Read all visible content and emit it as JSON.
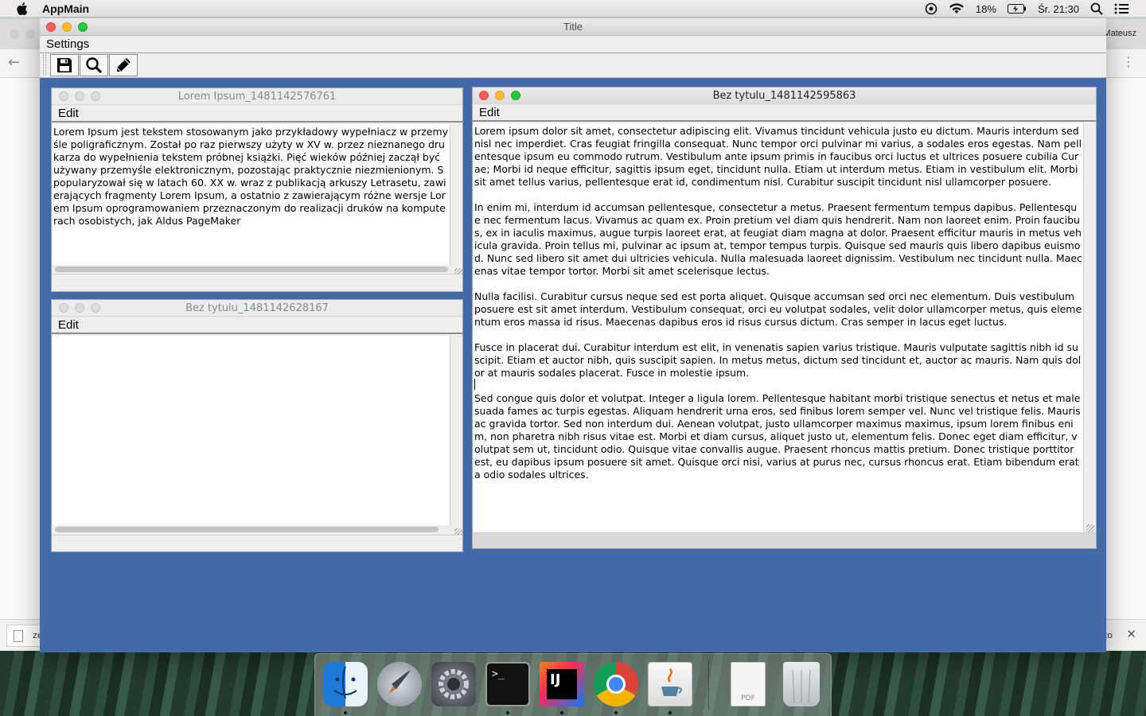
{
  "menubar": {
    "app_name": "AppMain",
    "battery": "18%",
    "clock": "Śr. 21:30"
  },
  "background_browser": {
    "user": "Mateusz",
    "download_file": "ze",
    "download_right": "ko"
  },
  "main_window": {
    "title": "Title",
    "menu_settings": "Settings",
    "toolbar": [
      "save-icon",
      "search-icon",
      "pencil-icon"
    ]
  },
  "frames": {
    "lorem": {
      "title": "Lorem Ipsum_1481142576761",
      "menu_edit": "Edit",
      "text": "Lorem Ipsum jest tekstem stosowanym jako przykładowy wypełniacz w przemyśle poligraficznym. Został po raz pierwszy użyty w XV w. przez nieznanego drukarza do wypełnienia tekstem próbnej książki. Pięć wieków później zaczął być używany przemyśle elektronicznym, pozostając praktycznie niezmienionym. Spopularyzował się w latach 60. XX w. wraz z publikacją arkuszy Letrasetu, zawierających fragmenty Lorem Ipsum, a ostatnio z zawierającym różne wersje Lorem Ipsum oprogramowaniem przeznaczonym do realizacji druków na komputerach osobistych, jak Aldus PageMaker"
    },
    "empty": {
      "title": "Bez tytulu_1481142628167",
      "menu_edit": "Edit",
      "text": ""
    },
    "big": {
      "title": "Bez tytulu_1481142595863",
      "menu_edit": "Edit",
      "text": "Lorem ipsum dolor sit amet, consectetur adipiscing elit. Vivamus tincidunt vehicula justo eu dictum. Mauris interdum sed nisl nec imperdiet. Cras feugiat fringilla consequat. Nunc tempor orci pulvinar mi varius, a sodales eros egestas. Nam pellentesque ipsum eu commodo rutrum. Vestibulum ante ipsum primis in faucibus orci luctus et ultrices posuere cubilia Curae; Morbi id neque efficitur, sagittis ipsum eget, tincidunt nulla. Etiam ut interdum metus. Etiam in vestibulum elit. Morbi sit amet tellus varius, pellentesque erat id, condimentum nisl. Curabitur suscipit tincidunt nisl ullamcorper posuere.\n\nIn enim mi, interdum id accumsan pellentesque, consectetur a metus. Praesent fermentum tempus dapibus. Pellentesque nec fermentum lacus. Vivamus ac quam ex. Proin pretium vel diam quis hendrerit. Nam non laoreet enim. Proin faucibus, ex in iaculis maximus, augue turpis laoreet erat, at feugiat diam magna at dolor. Praesent efficitur mauris in metus vehicula gravida. Proin tellus mi, pulvinar ac ipsum at, tempor tempus turpis. Quisque sed mauris quis libero dapibus euismod. Nunc sed libero sit amet dui ultricies vehicula. Nulla malesuada laoreet dignissim. Vestibulum nec tincidunt nulla. Maecenas vitae tempor tortor. Morbi sit amet scelerisque lectus.\n\nNulla facilisi. Curabitur cursus neque sed est porta aliquet. Quisque accumsan sed orci nec elementum. Duis vestibulum posuere est sit amet interdum. Vestibulum consequat, orci eu volutpat sodales, velit dolor ullamcorper metus, quis elementum eros massa id risus. Maecenas dapibus eros id risus cursus dictum. Cras semper in lacus eget luctus.\n\nFusce in placerat dui. Curabitur interdum est elit, in venenatis sapien varius tristique. Mauris vulputate sagittis nibh id suscipit. Etiam et auctor nibh, quis suscipit sapien. In metus metus, dictum sed tincidunt et, auctor ac mauris. Nam quis dolor at mauris sodales placerat. Fusce in molestie ipsum.\n\nSed congue quis dolor et volutpat. Integer a ligula lorem. Pellentesque habitant morbi tristique senectus et netus et malesuada fames ac turpis egestas. Aliquam hendrerit urna eros, sed finibus lorem semper vel. Nunc vel tristique felis. Mauris ac gravida tortor. Sed non interdum dui. Aenean volutpat, justo ullamcorper maximus maximus, ipsum lorem finibus enim, non pharetra nibh risus vitae est. Morbi et diam cursus, aliquet justo ut, elementum felis. Donec eget diam efficitur, volutpat sem ut, tincidunt odio. Quisque vitae convallis augue. Praesent rhoncus mattis pretium. Donec tristique porttitor est, eu dapibus ipsum posuere sit amet. Quisque orci nisi, varius at purus nec, cursus rhoncus erat. Etiam bibendum erat a odio sodales ultrices."
    }
  },
  "dock": {
    "items": [
      "finder-icon",
      "launchpad-icon",
      "system-preferences-icon",
      "terminal-icon",
      "intellij-icon",
      "chrome-icon",
      "java-icon",
      "pdf-document-icon",
      "trash-icon"
    ],
    "pdf_label": "PDF",
    "terminal_prompt": ">_",
    "intellij_label": "IJ"
  },
  "colors": {
    "desktop_pane": "#4269a9",
    "close": "#fc5f57",
    "minimize": "#fdbc2e",
    "zoom": "#27c840"
  }
}
